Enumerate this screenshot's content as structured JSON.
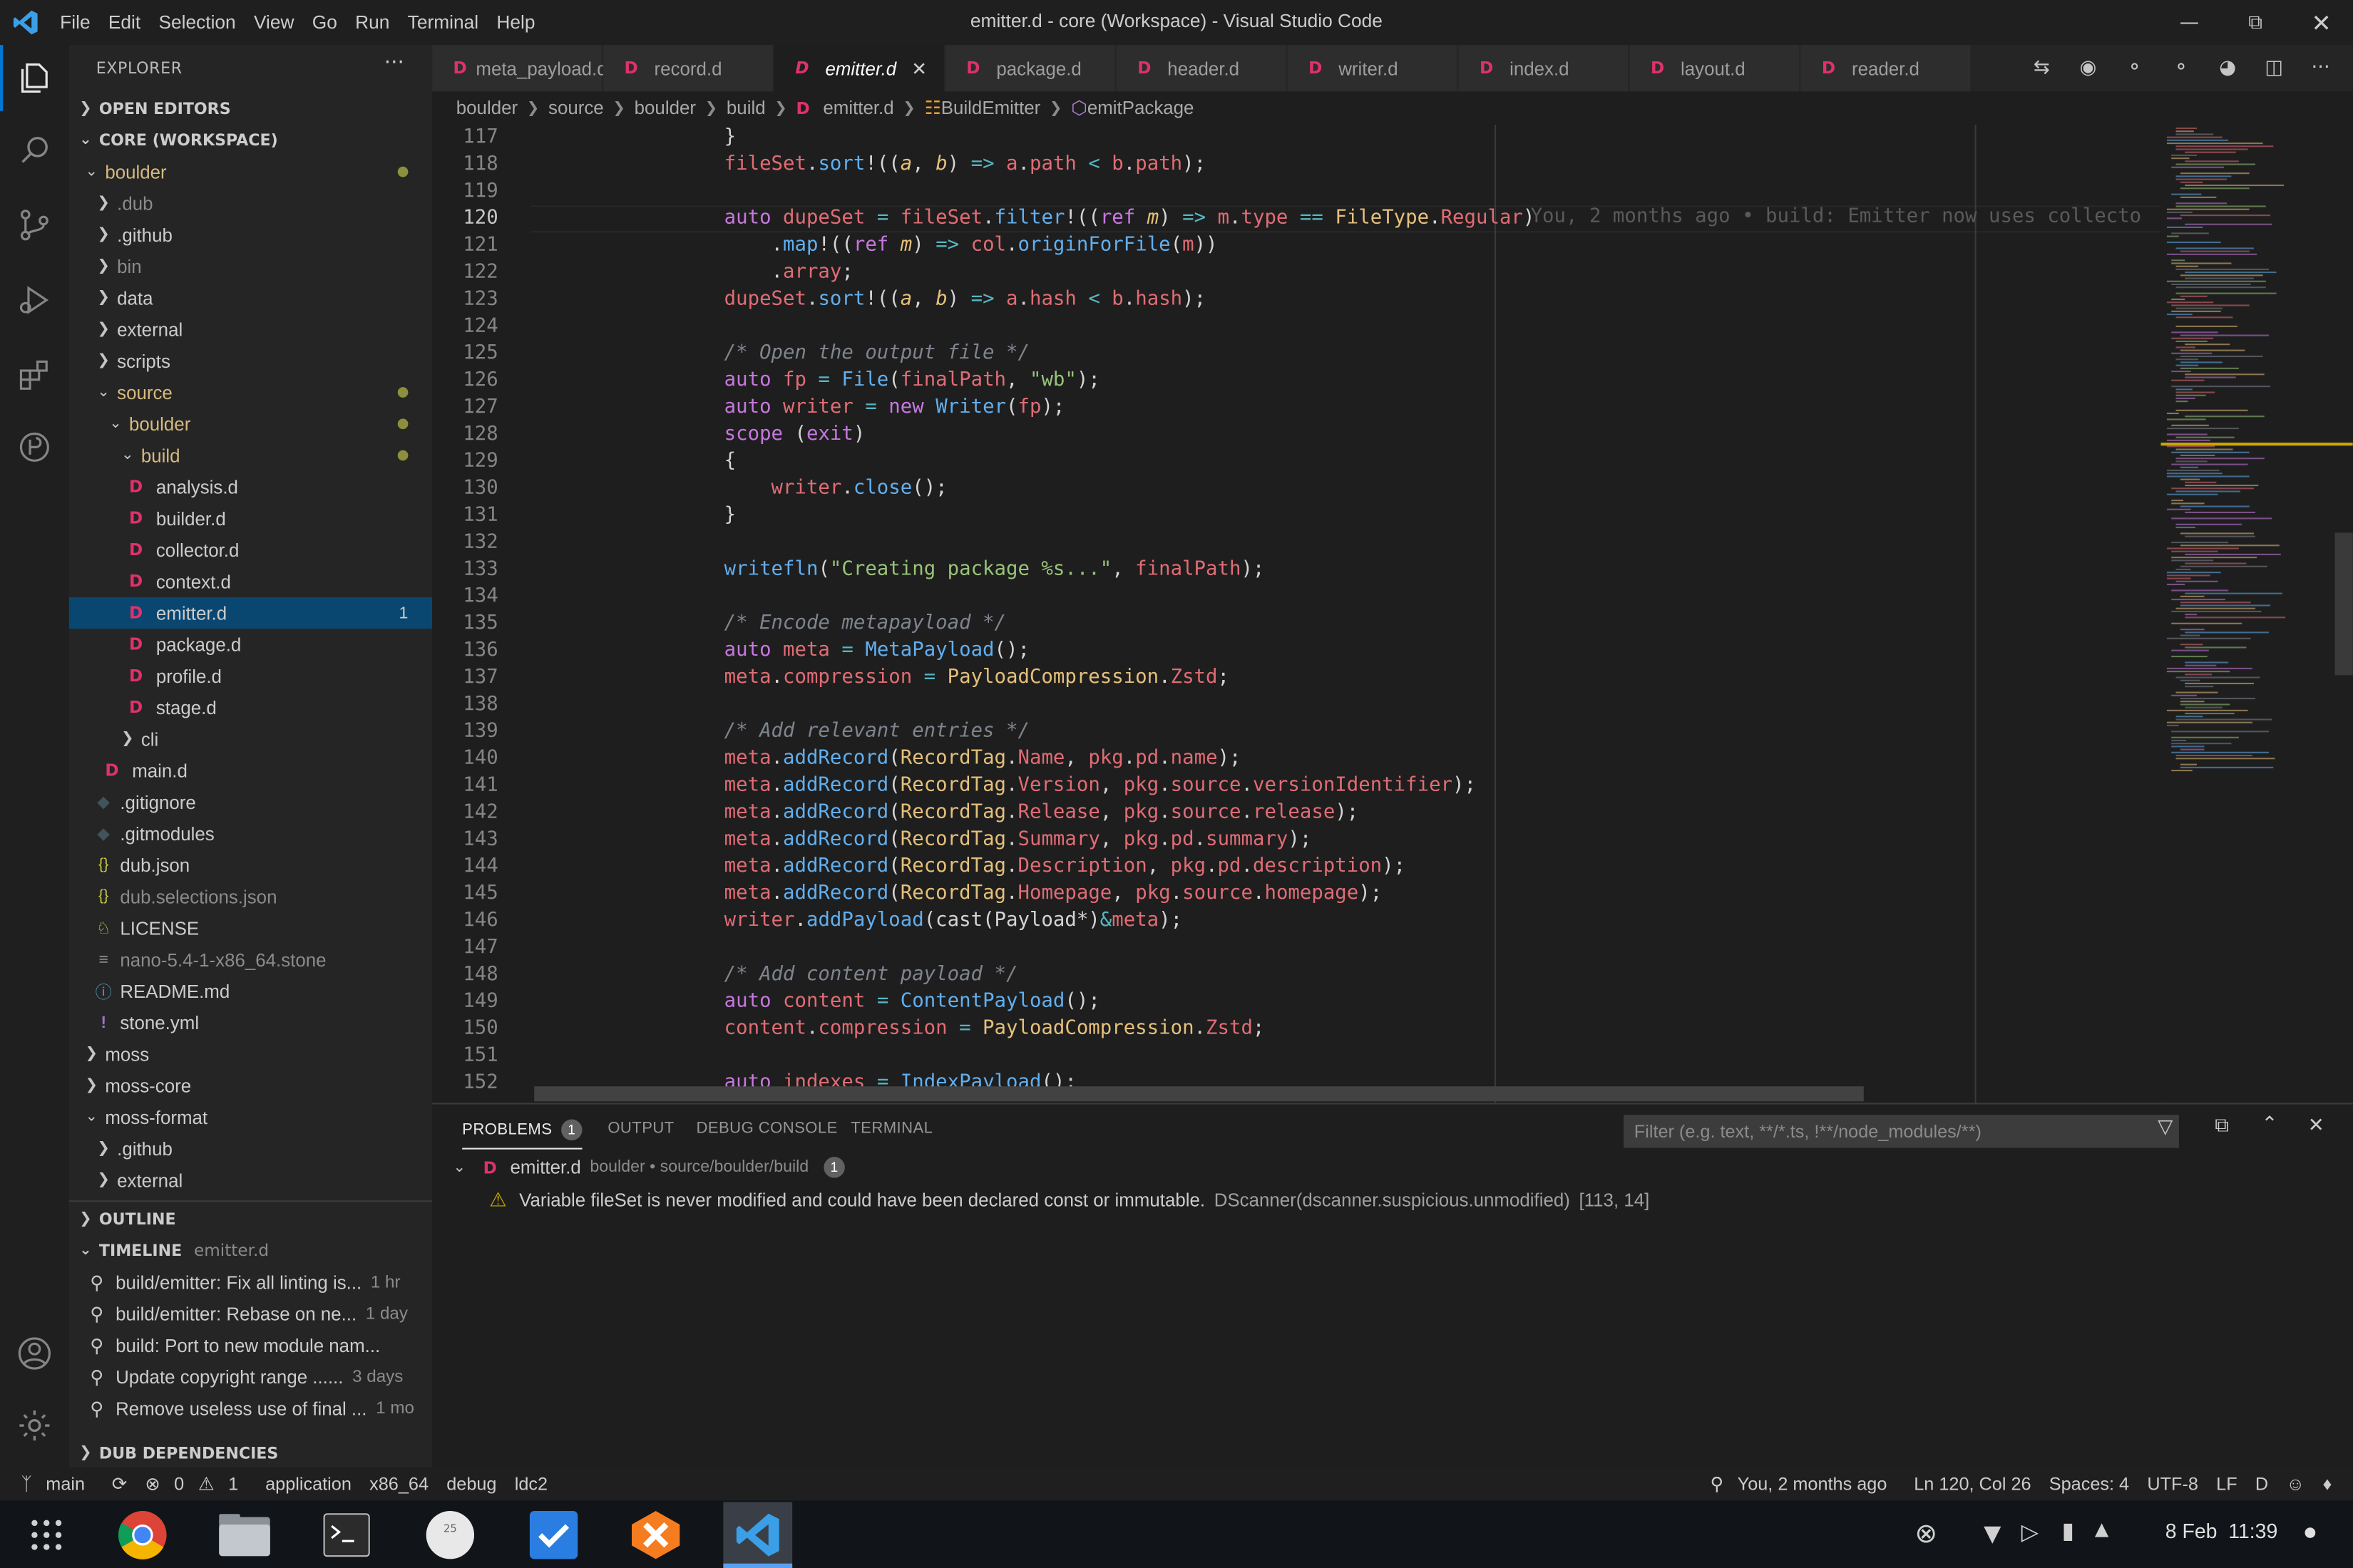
{
  "window": {
    "title": "emitter.d - core (Workspace) - Visual Studio Code"
  },
  "menu": [
    "File",
    "Edit",
    "Selection",
    "View",
    "Go",
    "Run",
    "Terminal",
    "Help"
  ],
  "sidebar": {
    "title": "EXPLORER",
    "open_editors": "OPEN EDITORS",
    "workspace": "CORE (WORKSPACE)",
    "outline": "OUTLINE",
    "timeline": "TIMELINE",
    "timeline_file": "emitter.d",
    "dub_deps": "DUB DEPENDENCIES",
    "tree": [
      {
        "label": "boulder",
        "kind": "folder-open",
        "depth": 1,
        "color": "#d7ba7d",
        "dot": true
      },
      {
        "label": ".dub",
        "kind": "folder",
        "depth": 2,
        "color": "#8b8b8b"
      },
      {
        "label": ".github",
        "kind": "folder",
        "depth": 2
      },
      {
        "label": "bin",
        "kind": "folder",
        "depth": 2,
        "color": "#8b8b8b"
      },
      {
        "label": "data",
        "kind": "folder",
        "depth": 2
      },
      {
        "label": "external",
        "kind": "folder",
        "depth": 2
      },
      {
        "label": "scripts",
        "kind": "folder",
        "depth": 2
      },
      {
        "label": "source",
        "kind": "folder-open",
        "depth": 2,
        "color": "#d7ba7d",
        "dot": true
      },
      {
        "label": "boulder",
        "kind": "folder-open",
        "depth": 3,
        "color": "#d7ba7d",
        "dot": true
      },
      {
        "label": "build",
        "kind": "folder-open",
        "depth": 4,
        "color": "#d7ba7d",
        "dot": true
      },
      {
        "label": "analysis.d",
        "kind": "d",
        "depth": 5
      },
      {
        "label": "builder.d",
        "kind": "d",
        "depth": 5
      },
      {
        "label": "collector.d",
        "kind": "d",
        "depth": 5
      },
      {
        "label": "context.d",
        "kind": "d",
        "depth": 5
      },
      {
        "label": "emitter.d",
        "kind": "d",
        "depth": 5,
        "selected": true,
        "badge": "1"
      },
      {
        "label": "package.d",
        "kind": "d",
        "depth": 5
      },
      {
        "label": "profile.d",
        "kind": "d",
        "depth": 5
      },
      {
        "label": "stage.d",
        "kind": "d",
        "depth": 5
      },
      {
        "label": "cli",
        "kind": "folder",
        "depth": 4
      },
      {
        "label": "main.d",
        "kind": "d",
        "depth": 3
      },
      {
        "label": ".gitignore",
        "kind": "git",
        "depth": 2
      },
      {
        "label": ".gitmodules",
        "kind": "git",
        "depth": 2
      },
      {
        "label": "dub.json",
        "kind": "json",
        "depth": 2
      },
      {
        "label": "dub.selections.json",
        "kind": "json",
        "depth": 2,
        "color": "#8b8b8b"
      },
      {
        "label": "LICENSE",
        "kind": "license",
        "depth": 2
      },
      {
        "label": "nano-5.4-1-x86_64.stone",
        "kind": "file",
        "depth": 2,
        "color": "#8b8b8b"
      },
      {
        "label": "README.md",
        "kind": "info",
        "depth": 2
      },
      {
        "label": "stone.yml",
        "kind": "yml",
        "depth": 2
      },
      {
        "label": "moss",
        "kind": "folder",
        "depth": 1
      },
      {
        "label": "moss-core",
        "kind": "folder",
        "depth": 1
      },
      {
        "label": "moss-format",
        "kind": "folder-open",
        "depth": 1
      },
      {
        "label": ".github",
        "kind": "folder",
        "depth": 2
      },
      {
        "label": "external",
        "kind": "folder",
        "depth": 2
      }
    ],
    "timeline_items": [
      {
        "label": "build/emitter: Fix all linting is...",
        "time": "1 hr"
      },
      {
        "label": "build/emitter: Rebase on ne...",
        "time": "1 day"
      },
      {
        "label": "build: Port to new module nam...",
        "time": ""
      },
      {
        "label": "Update copyright range ......",
        "time": "3 days"
      },
      {
        "label": "Remove useless use of final ...",
        "time": "1 mo"
      }
    ]
  },
  "tabs": [
    "meta_payload.d",
    "record.d",
    "emitter.d",
    "package.d",
    "header.d",
    "writer.d",
    "index.d",
    "layout.d",
    "reader.d"
  ],
  "active_tab": 2,
  "breadcrumb": [
    "boulder",
    "source",
    "boulder",
    "build",
    "emitter.d",
    "BuildEmitter",
    "emitPackage"
  ],
  "editor": {
    "line_numbers": [
      "117",
      "118",
      "119",
      "120",
      "121",
      "122",
      "123",
      "124",
      "125",
      "126",
      "127",
      "128",
      "129",
      "130",
      "131",
      "132",
      "133",
      "134",
      "135",
      "136",
      "137",
      "138",
      "139",
      "140",
      "141",
      "142",
      "143",
      "144",
      "145",
      "146",
      "147",
      "148",
      "149",
      "150",
      "151",
      "152"
    ],
    "current_line": "120",
    "blame": "You, 2 months ago • build: Emitter now uses collecto"
  },
  "panel": {
    "tabs": [
      "PROBLEMS",
      "OUTPUT",
      "DEBUG CONSOLE",
      "TERMINAL"
    ],
    "problems_count": "1",
    "filter_placeholder": "Filter (e.g. text, **/*.ts, !**/node_modules/**)",
    "file": "emitter.d",
    "file_path": "boulder • source/boulder/build",
    "file_count": "1",
    "message": "Variable fileSet is never modified and could have been declared const or immutable.",
    "source": "DScanner(dscanner.suspicious.unmodified)",
    "position": "[113, 14]"
  },
  "status": {
    "branch": "main",
    "errors": "0",
    "warnings": "1",
    "config": "application",
    "arch": "x86_64",
    "build": "debug",
    "compiler": "ldc2",
    "blame": "You, 2 months ago",
    "cursor": "Ln 120, Col 26",
    "spaces": "Spaces: 4",
    "encoding": "UTF-8",
    "eol": "LF",
    "lang": "D"
  },
  "taskbar": {
    "date": "8 Feb",
    "time": "11:39",
    "calendar_day": "25"
  },
  "colors": {
    "accent": "#0078d4",
    "selection": "#094771",
    "d_icon": "#e0316b"
  }
}
